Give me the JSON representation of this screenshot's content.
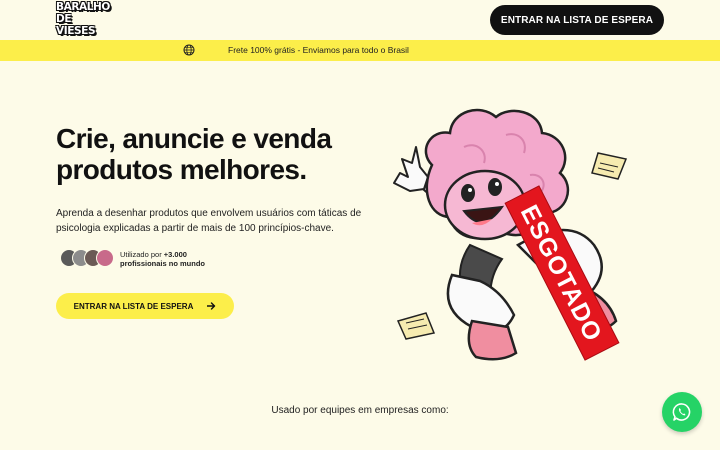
{
  "header": {
    "logo_line1": "BARALHO",
    "logo_line2": "DE VIESES",
    "cta_label": "ENTRAR NA LISTA DE ESPERA"
  },
  "banner": {
    "icon": "globe-icon",
    "text": "Frete 100% grátis - Enviamos para todo o Brasil"
  },
  "hero": {
    "headline_line1": "Crie, anuncie e venda",
    "headline_line2": "produtos melhores.",
    "description_line1": "Aprenda a desenhar produtos que envolvem usuários com táticas  de",
    "description_line2": "psicologia explicadas a partir de mais de 100 princípios-chave.",
    "users_prefix": "Utilizado por ",
    "users_count": "+3.000",
    "users_suffix": "profissionais no mundo",
    "cta_label": "ENTRAR NA LISTA DE ESPERA",
    "badge": "ESGOTADO"
  },
  "companies_label": "Usado por equipes em empresas como:",
  "colors": {
    "accent_yellow": "#fcee4a",
    "background": "#fdfbe8",
    "dark": "#111111",
    "badge_red": "#e3161e",
    "whatsapp_green": "#25d366"
  }
}
